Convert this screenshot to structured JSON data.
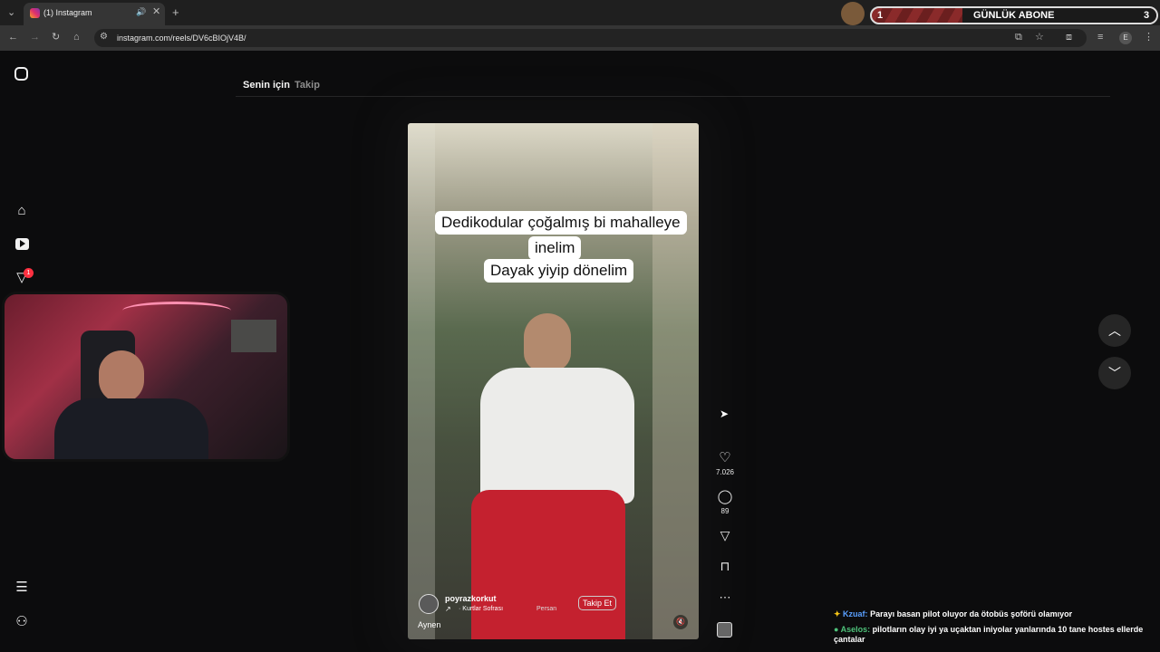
{
  "browser": {
    "tab_title": "(1) Instagram",
    "url": "instagram.com/reels/DV6cBIOjV4B/",
    "widget": {
      "rank": "1",
      "title": "GÜNLÜK ABONE",
      "count": "3"
    }
  },
  "instagram": {
    "tabs": [
      "Senin için",
      "Takip"
    ],
    "notification_badge": "1",
    "reel": {
      "caption_lines": [
        "Dedikodular çoğalmış bi mahalleye",
        "inelim",
        "Dayak yiyip dönelim"
      ],
      "author": "poyrazkorkut",
      "audio": "· Kurtlar Sofrası",
      "audio_extra": "Persan",
      "follow": "Takip Et",
      "tag": "Aynen",
      "likes": "7.026",
      "comments": "89"
    }
  },
  "chat": {
    "messages": [
      {
        "user": "Kzuaf:",
        "text": "Parayı basan pilot oluyor da ötobüs şoförü olamıyor",
        "color": "#5aa0ff"
      },
      {
        "user": "Aselos:",
        "text": "pilotların olay iyi ya uçaktan iniyolar yanlarında 10 tane hostes ellerde çantalar",
        "color": "#4ec27a"
      }
    ]
  }
}
